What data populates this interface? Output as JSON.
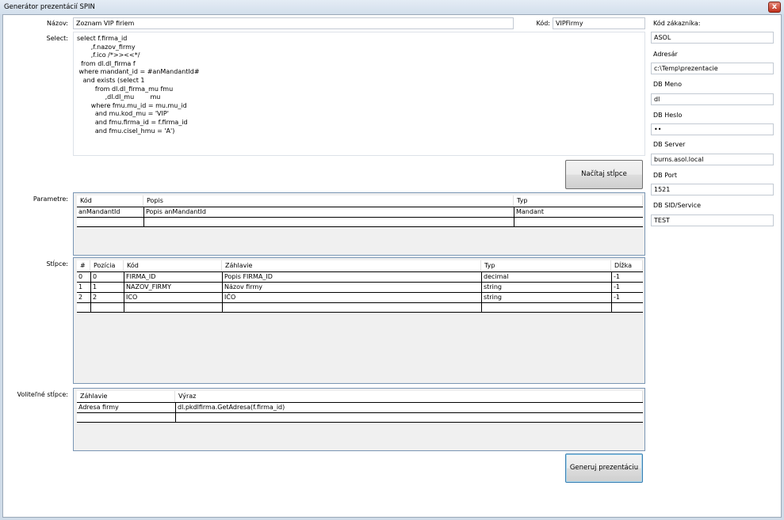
{
  "window": {
    "title": "Generátor prezentácií SPIN",
    "close_label": "x"
  },
  "form": {
    "nazov_label": "Názov:",
    "nazov_value": "Zoznam VIP firiem",
    "kod_label": "Kód:",
    "kod_value": "VIPFirmy",
    "select_label": "Select:",
    "select_value": "select f.firma_id\n       ,f.nazov_firmy\n       ,f.ico /*>><<*/\n  from dl.dl_firma f\n where mandant_id = #anMandantId#\n   and exists (select 1\n         from dl.dl_firma_mu fmu\n              ,dl.dl_mu        mu\n       where fmu.mu_id = mu.mu_id\n         and mu.kod_mu = 'VIP'\n         and fmu.firma_id = f.firma_id\n         and fmu.cisel_hmu = 'A')",
    "load_columns_button": "Načítaj stĺpce",
    "generate_button": "Generuj prezentáciu"
  },
  "sidebar": {
    "kod_zakaznika_label": "Kód zákazníka:",
    "kod_zakaznika_value": "ASOL",
    "adresar_label": "Adresár",
    "adresar_value": "c:\\Temp\\prezentacie",
    "db_meno_label": "DB Meno",
    "db_meno_value": "dl",
    "db_heslo_label": "DB Heslo",
    "db_heslo_value": "••",
    "db_server_label": "DB Server",
    "db_server_value": "burns.asol.local",
    "db_port_label": "DB Port",
    "db_port_value": "1521",
    "db_sid_label": "DB SID/Service",
    "db_sid_value": "TEST"
  },
  "parametre": {
    "label": "Parametre:",
    "headers": [
      "Kód",
      "Popis",
      "Typ"
    ],
    "rows": [
      [
        "anMandantId",
        "Popis anMandantId",
        "Mandant"
      ]
    ]
  },
  "stlpce": {
    "label": "Stĺpce:",
    "headers": [
      "#",
      "Pozícia",
      "Kód",
      "Záhlavie",
      "Typ",
      "Dĺžka"
    ],
    "rows": [
      [
        "0",
        "0",
        "FIRMA_ID",
        "Popis FIRMA_ID",
        "decimal",
        "-1"
      ],
      [
        "1",
        "1",
        "NAZOV_FIRMY",
        "Názov firmy",
        "string",
        "-1"
      ],
      [
        "2",
        "2",
        "ICO",
        "IČO",
        "string",
        "-1"
      ]
    ]
  },
  "volitelne": {
    "label": "Voliteľné stĺpce:",
    "headers": [
      "Záhlavie",
      "Výraz"
    ],
    "rows": [
      [
        "Adresa firmy",
        "dl.pkdlfirma.GetAdresa(f.firma_id)"
      ]
    ]
  }
}
